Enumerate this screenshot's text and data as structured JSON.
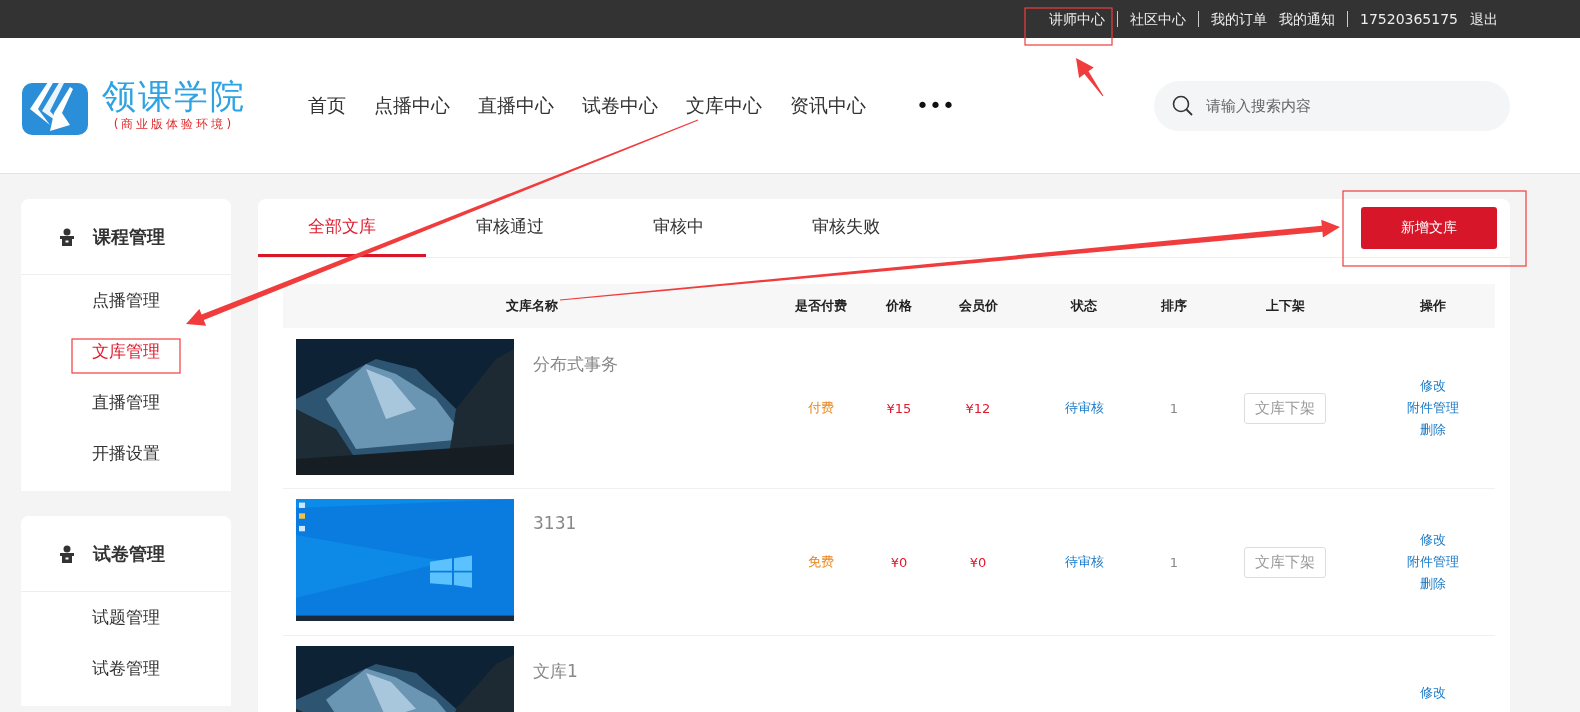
{
  "top_bar": {
    "links": [
      {
        "label": "讲师中心",
        "separator_after": true
      },
      {
        "label": "社区中心",
        "separator_after": true
      },
      {
        "label": "我的订单",
        "separator_after": false
      },
      {
        "label": "我的通知",
        "separator_after": true
      },
      {
        "label": "17520365175",
        "separator_after": false
      },
      {
        "label": "退出",
        "separator_after": false
      }
    ]
  },
  "logo": {
    "name": "领课学院",
    "tagline": "(商业版体验环境)"
  },
  "nav": {
    "items": [
      "首页",
      "点播中心",
      "直播中心",
      "试卷中心",
      "文库中心",
      "资讯中心"
    ],
    "more": "•••"
  },
  "search": {
    "placeholder": "请输入搜索内容"
  },
  "sidebar": {
    "groups": [
      {
        "title": "课程管理",
        "items": [
          {
            "label": "点播管理",
            "selected": false
          },
          {
            "label": "文库管理",
            "selected": true
          },
          {
            "label": "直播管理",
            "selected": false
          },
          {
            "label": "开播设置",
            "selected": false
          }
        ]
      },
      {
        "title": "试卷管理",
        "items": [
          {
            "label": "试题管理",
            "selected": false
          },
          {
            "label": "试卷管理",
            "selected": false
          }
        ]
      }
    ]
  },
  "tabs": [
    {
      "label": "全部文库",
      "selected": true
    },
    {
      "label": "审核通过",
      "selected": false
    },
    {
      "label": "审核中",
      "selected": false
    },
    {
      "label": "审核失败",
      "selected": false
    }
  ],
  "new_button": "新增文库",
  "table": {
    "columns": [
      "文库名称",
      "是否付费",
      "价格",
      "会员价",
      "状态",
      "排序",
      "上下架",
      "操作"
    ],
    "rows": [
      {
        "thumbnail": {
          "kind": "picture"
        },
        "title": "分布式事务",
        "paid": "付费",
        "price": "¥15",
        "member_price": "¥12",
        "status": "待审核",
        "sort": "1",
        "shelf_button": "文库下架",
        "actions": [
          "修改",
          "附件管理",
          "删除"
        ]
      },
      {
        "thumbnail": {
          "kind": "picture"
        },
        "title": "3131",
        "paid": "免费",
        "price": "¥0",
        "member_price": "¥0",
        "status": "待审核",
        "sort": "1",
        "shelf_button": "文库下架",
        "actions": [
          "修改",
          "附件管理",
          "删除"
        ]
      },
      {
        "thumbnail": {
          "kind": "picture"
        },
        "title": "文库1",
        "actions": [
          "修改"
        ]
      }
    ]
  }
}
